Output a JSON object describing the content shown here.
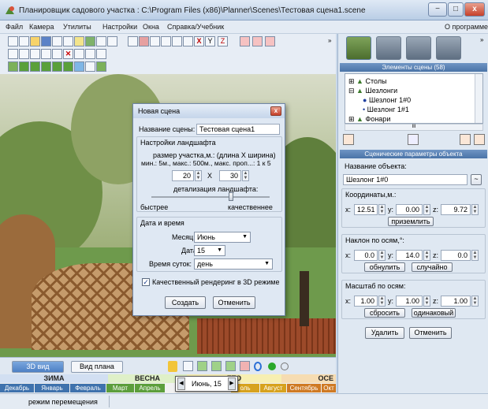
{
  "window": {
    "title": "Планировщик садового участка : C:\\Program Files (x86)\\Planner\\Scenes\\Тестовая сцена1.scene",
    "min": "−",
    "max": "□",
    "close": "x"
  },
  "menu": {
    "items": [
      "Файл",
      "Камера",
      "Утилиты",
      "Настройки",
      "Окна",
      "Справка/Учебник"
    ],
    "right": "О программе"
  },
  "toolbar": {
    "y_label": "Y",
    "z_label": "Z",
    "overflow": "»"
  },
  "view_tabs": {
    "tab3d": "3D вид",
    "tabplan": "Вид плана"
  },
  "seasons": {
    "winter": "ЗИМА",
    "spring": "ВЕСНА",
    "summer": "ЕТО",
    "autumn": "ОСЕ"
  },
  "months": [
    "Декабрь",
    "Январь",
    "Февраль",
    "Март",
    "Апрель",
    "оль",
    "Август",
    "Сентябрь",
    "Окт"
  ],
  "timeline": {
    "value": "Июнь, 15",
    "prev": "◀",
    "next": "▶"
  },
  "status": {
    "mode": "режим перемещения"
  },
  "right_panel": {
    "elements_header": "Элементы сцены (58)",
    "tree": [
      "Столы",
      "Шезлонги",
      "Шезлонг 1#0",
      "Шезлонг 1#1",
      "Фонари"
    ],
    "tree_scroll": "III",
    "params_header": "Сценические параметры объекта",
    "name_label": "Название объекта:",
    "name_value": "Шезлонг 1#0",
    "coords_label": "Координаты,м.:",
    "coords": {
      "x": "12.51",
      "y": "0.00",
      "z": "9.72"
    },
    "ground_btn": "приземлить",
    "tilt_label": "Наклон по осям,°:",
    "tilt": {
      "x": "0.0",
      "y": "14.0",
      "z": "0.0"
    },
    "reset_btn": "обнулить",
    "random_btn": "случайно",
    "scale_label": "Масштаб по осям:",
    "scale": {
      "x": "1.00",
      "y": "1.00",
      "z": "1.00"
    },
    "scale_reset_btn": "сбросить",
    "scale_same_btn": "одинаковый",
    "delete_btn": "Удалить",
    "cancel_btn": "Отменить",
    "axis": {
      "x": "x:",
      "y": "y:",
      "z": "z:"
    }
  },
  "dialog": {
    "title": "Новая сцена",
    "close": "x",
    "name_label": "Название сцены:",
    "name_value": "Тестовая сцена1",
    "landscape_label": "Настройки ландшафта",
    "size_line1": "размер участка,м.: (длина X ширина)",
    "size_line2": "мин.: 5м., макс.: 500м., макс. проп...: 1 к 5",
    "length": "20",
    "width": "30",
    "x_sep": "X",
    "detail_label": "детализация ландшафта:",
    "faster": "быстрее",
    "better": "качественнее",
    "datetime_label": "Дата и время",
    "month_label": "Месяц:",
    "month_value": "Июнь",
    "date_label": "Дата:",
    "date_value": "15",
    "time_label": "Время суток:",
    "time_value": "день",
    "hq_label": "Качественный рендеринг в 3D режиме",
    "create_btn": "Создать",
    "cancel_btn": "Отменить"
  }
}
